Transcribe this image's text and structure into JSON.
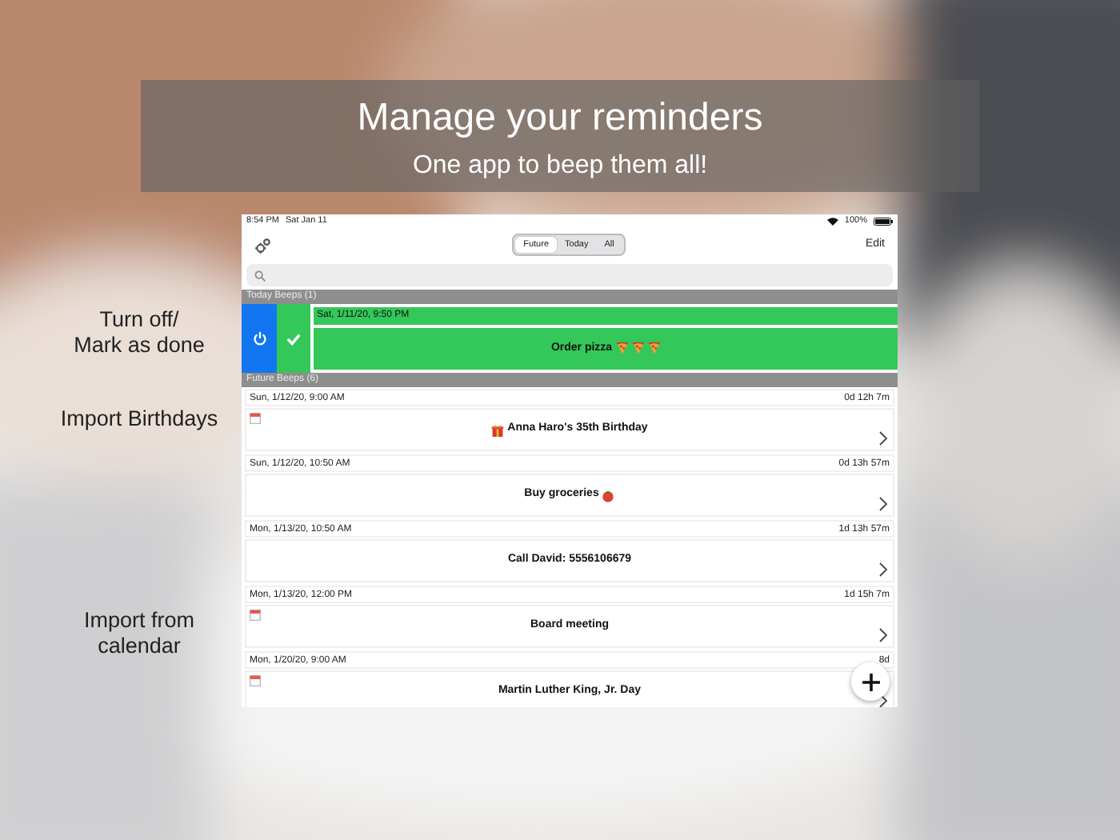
{
  "banner": {
    "title": "Manage your reminders",
    "subtitle": "One app to beep them all!"
  },
  "callouts": [
    "Turn off/\nMark as done",
    "Import Birthdays",
    "Import from\ncalendar"
  ],
  "status_bar": {
    "time": "8:54 PM",
    "date": "Sat Jan 11",
    "battery": "100%"
  },
  "segments": [
    {
      "label": "Future",
      "selected": true
    },
    {
      "label": "Today",
      "selected": false
    },
    {
      "label": "All",
      "selected": false
    }
  ],
  "edit_button": "Edit",
  "sections": [
    {
      "title": "Today Beeps (1)",
      "kind": "today",
      "items": [
        {
          "date": "Sat, 1/11/20, 9:50 PM",
          "title": "Order pizza",
          "kind": "pizza",
          "from_calendar": false
        }
      ]
    },
    {
      "title": "Future Beeps (6)",
      "kind": "future",
      "items": [
        {
          "date": "Sun, 1/12/20, 9:00 AM",
          "countdown": "0d 12h 7m",
          "title": "Anna Haro's 35th Birthday",
          "kind": "birthday",
          "from_calendar": true
        },
        {
          "date": "Sun, 1/12/20, 10:50 AM",
          "countdown": "0d 13h 57m",
          "title": "Buy groceries",
          "kind": "groceries",
          "from_calendar": false
        },
        {
          "date": "Mon, 1/13/20, 10:50 AM",
          "countdown": "1d 13h 57m",
          "title": "Call David: 5556106679",
          "kind": "plain",
          "from_calendar": false
        },
        {
          "date": "Mon, 1/13/20, 12:00 PM",
          "countdown": "1d 15h 7m",
          "title": "Board meeting",
          "kind": "plain",
          "from_calendar": true
        },
        {
          "date": "Mon, 1/20/20, 9:00 AM",
          "countdown": "8d",
          "title": "Martin Luther King, Jr. Day",
          "kind": "plain",
          "from_calendar": true
        }
      ]
    }
  ]
}
